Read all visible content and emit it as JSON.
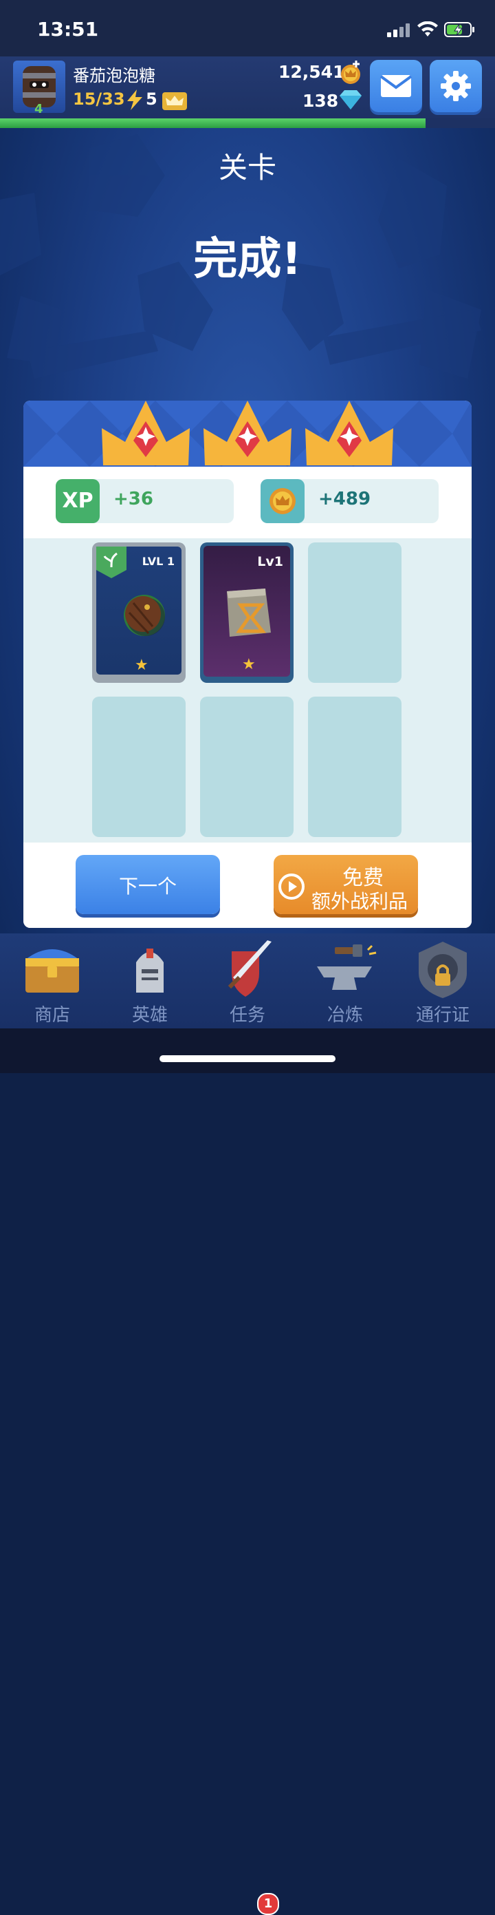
{
  "status_bar": {
    "time": "13:51"
  },
  "header": {
    "username": "番茄泡泡糖",
    "player_level": "4",
    "energy": "15/33",
    "crowns": "5",
    "gold": "12,541",
    "gems": "138",
    "xp_progress_fraction": 0.86
  },
  "screen": {
    "title": "关卡",
    "result": "完成!"
  },
  "rewards": {
    "stars_earned": 3,
    "xp_label": "XP",
    "xp_value": "+36",
    "coin_value": "+489"
  },
  "loot": {
    "cards": [
      {
        "level": "LVL 1",
        "stars": "★",
        "item": "shield"
      },
      {
        "level": "Lv1",
        "stars": "★",
        "item": "hourglass-stone"
      }
    ],
    "empty_slots": 4
  },
  "buttons": {
    "next": "下一个",
    "free_line1": "免费",
    "free_line2": "额外战利品"
  },
  "nav": [
    {
      "label": "商店",
      "icon": "chest-icon"
    },
    {
      "label": "英雄",
      "icon": "knight-helmet-icon"
    },
    {
      "label": "任务",
      "icon": "sword-shield-icon",
      "badge": "1"
    },
    {
      "label": "冶炼",
      "icon": "anvil-icon"
    },
    {
      "label": "通行证",
      "icon": "locked-pass-icon"
    }
  ],
  "colors": {
    "accent_blue": "#3a7fe4",
    "accent_orange": "#e78b2a",
    "xp_green": "#45b06a"
  }
}
